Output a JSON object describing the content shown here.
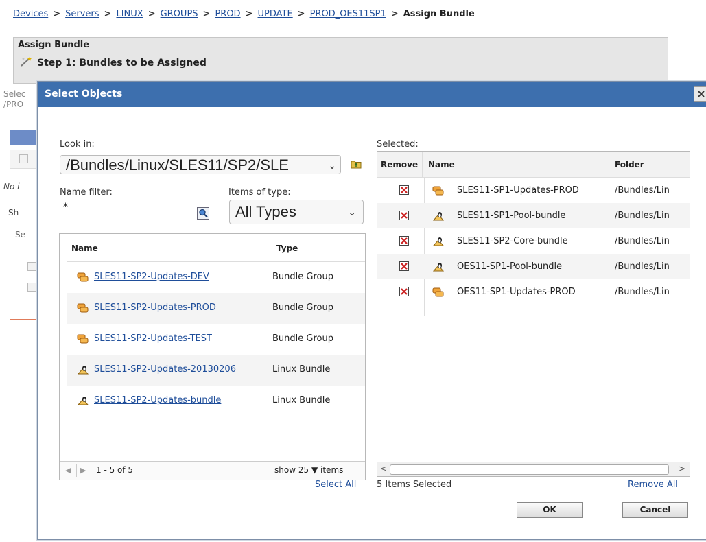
{
  "breadcrumb": {
    "items": [
      "Devices",
      "Servers",
      "LINUX",
      "GROUPS",
      "PROD",
      "UPDATE",
      "PROD_OES11SP1"
    ],
    "current": "Assign Bundle",
    "separator": ">"
  },
  "assign": {
    "title": "Assign Bundle",
    "step": "Step 1: Bundles to be Assigned"
  },
  "background": {
    "fragment1": "Selec",
    "fragment2": "/PRO",
    "fragment3": "No i",
    "fragment4": "Sh",
    "fragment5": "Se"
  },
  "dialog": {
    "title": "Select Objects",
    "close": "×",
    "look_in_label": "Look in:",
    "look_in_value": "/Bundles/Linux/SLES11/SP2/SLE",
    "name_filter_label": "Name filter:",
    "name_filter_value": "*",
    "items_of_type_label": "Items of type:",
    "items_of_type_value": "All Types",
    "left_list": {
      "columns": [
        "Name",
        "Type"
      ],
      "rows": [
        {
          "name": "SLES11-SP2-Updates-DEV",
          "type": "Bundle Group",
          "icon": "bundle-group-icon"
        },
        {
          "name": "SLES11-SP2-Updates-PROD",
          "type": "Bundle Group",
          "icon": "bundle-group-icon"
        },
        {
          "name": "SLES11-SP2-Updates-TEST",
          "type": "Bundle Group",
          "icon": "bundle-group-icon"
        },
        {
          "name": "SLES11-SP2-Updates-20130206",
          "type": "Linux Bundle",
          "icon": "linux-bundle-icon"
        },
        {
          "name": "SLES11-SP2-Updates-bundle",
          "type": "Linux Bundle",
          "icon": "linux-bundle-icon"
        }
      ],
      "pager": {
        "range": "1 - 5 of 5",
        "show_label": "show",
        "show_value": "25",
        "items_label": "items"
      }
    },
    "select_all": "Select All",
    "selected_label": "Selected:",
    "right_list": {
      "columns": [
        "Remove",
        "Name",
        "Folder"
      ],
      "rows": [
        {
          "name": "SLES11-SP1-Updates-PROD",
          "folder": "/Bundles/Lin",
          "icon": "bundle-group-icon"
        },
        {
          "name": "SLES11-SP1-Pool-bundle",
          "folder": "/Bundles/Lin",
          "icon": "linux-bundle-icon"
        },
        {
          "name": "SLES11-SP2-Core-bundle",
          "folder": "/Bundles/Lin",
          "icon": "linux-bundle-icon"
        },
        {
          "name": "OES11-SP1-Pool-bundle",
          "folder": "/Bundles/Lin",
          "icon": "linux-bundle-icon"
        },
        {
          "name": "OES11-SP1-Updates-PROD",
          "folder": "/Bundles/Lin",
          "icon": "bundle-group-icon"
        }
      ]
    },
    "items_selected": "5 Items Selected",
    "remove_all": "Remove All",
    "ok": "OK",
    "cancel": "Cancel"
  },
  "colors": {
    "title_bar": "#3d6fae",
    "link": "#1f4e9a",
    "remove_icon": "#cc2222"
  }
}
